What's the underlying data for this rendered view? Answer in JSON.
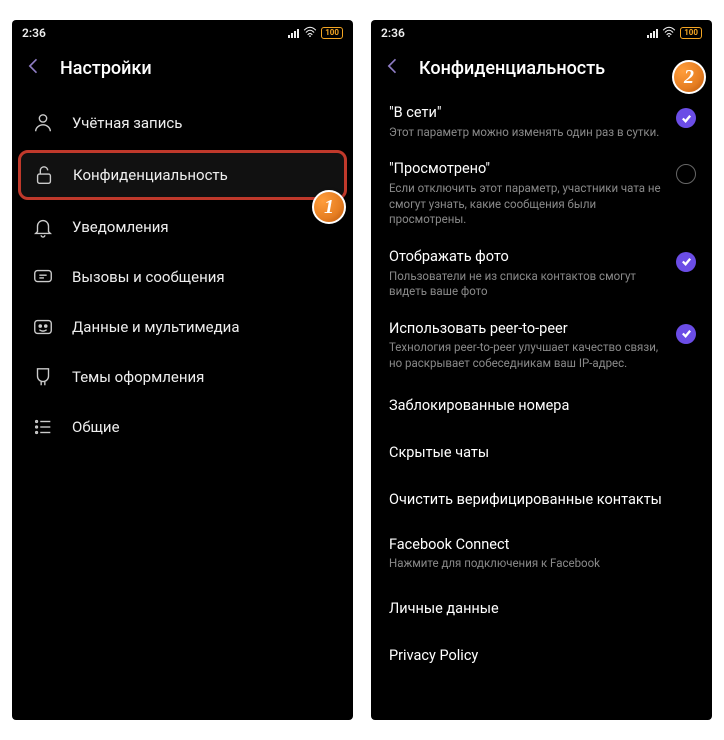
{
  "status": {
    "time": "2:36",
    "battery": "100"
  },
  "phone1": {
    "toolbar_title": "Настройки",
    "items": [
      {
        "label": "Учётная запись",
        "icon": "person-icon"
      },
      {
        "label": "Конфиденциальность",
        "icon": "lock-icon",
        "highlight": true
      },
      {
        "label": "Уведомления",
        "icon": "bell-icon"
      },
      {
        "label": "Вызовы и сообщения",
        "icon": "chat-icon"
      },
      {
        "label": "Данные и мультимедиа",
        "icon": "media-icon"
      },
      {
        "label": "Темы оформления",
        "icon": "brush-icon"
      },
      {
        "label": "Общие",
        "icon": "list-icon"
      }
    ]
  },
  "phone2": {
    "toolbar_title": "Конфиденциальность",
    "toggles": [
      {
        "title": "\"В сети\"",
        "desc": "Этот параметр можно изменять один раз в сутки.",
        "on": true
      },
      {
        "title": "\"Просмотрено\"",
        "desc": "Если отключить этот параметр, участники чата не смогут узнать, какие сообщения были просмотрены.",
        "on": false
      },
      {
        "title": "Отображать фото",
        "desc": "Пользователи не из списка контактов смогут видеть ваше фото",
        "on": true
      },
      {
        "title": "Использовать peer-to-peer",
        "desc": "Технология peer-to-peer улучшает качество связи, но раскрывает собеседникам ваш IP-адрес.",
        "on": true
      }
    ],
    "links": [
      {
        "title": "Заблокированные номера"
      },
      {
        "title": "Скрытые чаты"
      },
      {
        "title": "Очистить верифицированные контакты"
      },
      {
        "title": "Facebook Connect",
        "desc": "Нажмите для подключения к Facebook"
      },
      {
        "title": "Личные данные"
      },
      {
        "title": "Privacy Policy"
      }
    ]
  },
  "badges": {
    "one": "1",
    "two": "2"
  }
}
